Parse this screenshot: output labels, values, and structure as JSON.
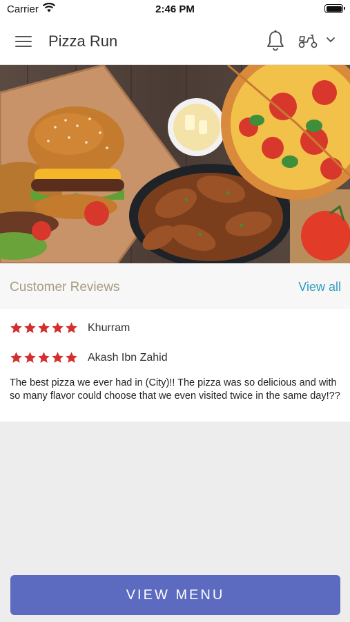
{
  "status_bar": {
    "carrier": "Carrier",
    "time": "2:46 PM"
  },
  "nav": {
    "title": "Pizza Run",
    "icons": {
      "menu": "hamburger-menu-icon",
      "notifications": "bell-icon",
      "delivery": "scooter-icon",
      "dropdown": "chevron-down-icon"
    }
  },
  "hero": {
    "image": "food-banner (burgers, pizza, chicken wings)"
  },
  "reviews": {
    "title": "Customer Reviews",
    "view_all": "View all",
    "items": [
      {
        "name": "Khurram",
        "rating": 5,
        "text": ""
      },
      {
        "name": "Akash Ibn Zahid",
        "rating": 5,
        "text": "The best pizza we ever had in (City)!! The pizza was so delicious and with so many flavor could choose that we even visited twice in the same day!??"
      }
    ]
  },
  "footer": {
    "button_label": "VIEW MENU"
  },
  "colors": {
    "accent": "#5c6bc0",
    "link": "#2d9bc2",
    "star": "#d32f2f",
    "section_title": "#a89b82"
  }
}
